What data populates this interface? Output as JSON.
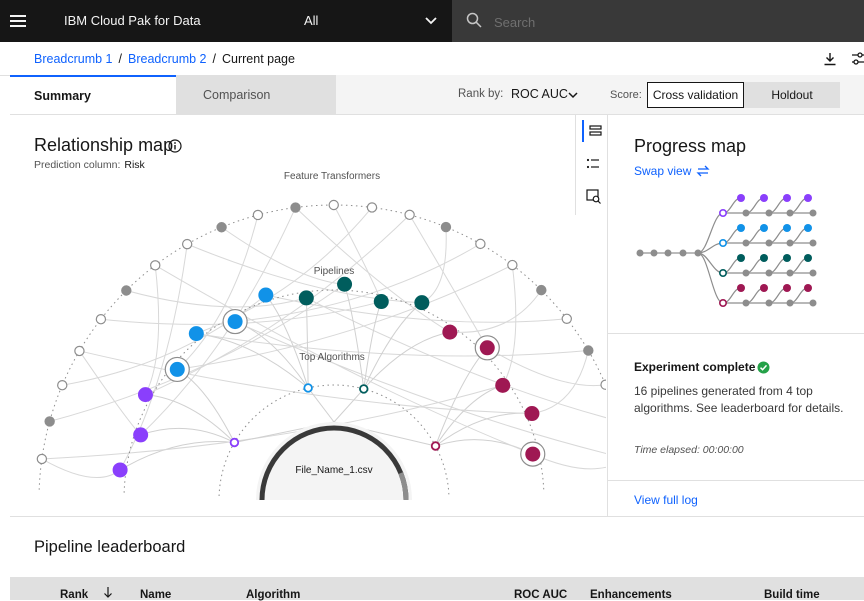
{
  "header": {
    "brand": "IBM Cloud Pak for Data",
    "context_value": "All",
    "search_placeholder": "Search"
  },
  "breadcrumb": {
    "items": [
      "Breadcrumb 1",
      "Breadcrumb 2",
      "Current page"
    ],
    "separator": "/"
  },
  "tabs": {
    "summary": "Summary",
    "comparison": "Comparison"
  },
  "rank": {
    "label": "Rank by:",
    "value": "ROC AUC"
  },
  "score": {
    "label": "Score:",
    "options": [
      "Cross validation",
      "Holdout"
    ],
    "selected": "Cross validation"
  },
  "relationship_map": {
    "title": "Relationship map",
    "prediction_label": "Prediction column:",
    "prediction_value": "Risk",
    "ring_labels": [
      "Feature Transformers",
      "Pipelines",
      "Top Algorithms"
    ],
    "center_file": "File_Name_1.csv",
    "colors": {
      "purple": "#8a3ffc",
      "blue": "#1192e8",
      "teal": "#005d5d",
      "magenta": "#9f1853",
      "gray": "#8d8d8d"
    }
  },
  "progress_map": {
    "title": "Progress map",
    "swap_label": "Swap view"
  },
  "experiment": {
    "status": "Experiment complete",
    "description": "16 pipelines generated from 4 top algorithms. See leaderboard for details.",
    "elapsed": "Time elapsed: 00:00:00",
    "view_log": "View full log"
  },
  "leaderboard": {
    "title": "Pipeline leaderboard",
    "columns": [
      "Rank",
      "Name",
      "Algorithm",
      "ROC AUC",
      "Enhancements",
      "Build time"
    ]
  }
}
